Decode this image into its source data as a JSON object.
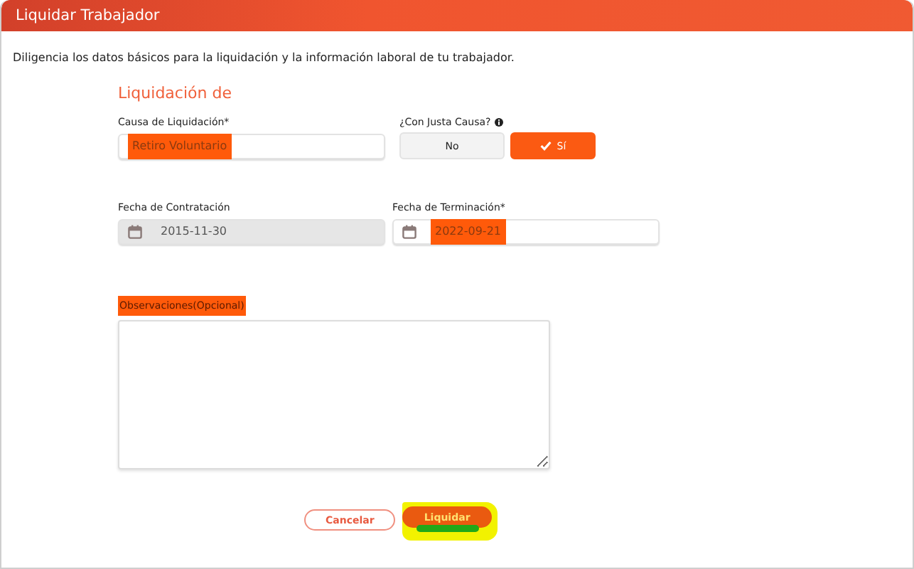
{
  "window": {
    "title": "Liquidar Trabajador"
  },
  "intro": "Diligencia los datos básicos para la liquidación y la información laboral de tu trabajador.",
  "section_title": "Liquidación de",
  "cause": {
    "label": "Causa de Liquidación*",
    "value": "Retiro Voluntario",
    "highlighted": true
  },
  "just_cause": {
    "label": "¿Con Justa Causa?",
    "options": [
      {
        "label": "No",
        "selected": false
      },
      {
        "label": "Sí",
        "selected": true
      }
    ]
  },
  "hire_date": {
    "label": "Fecha de Contratación",
    "value": "2015-11-30",
    "disabled": true,
    "highlighted": false
  },
  "end_date": {
    "label": "Fecha de Terminación*",
    "value": "2022-09-21",
    "disabled": false,
    "highlighted": true
  },
  "notes": {
    "label": "Observaciones(Opcional)",
    "label_highlighted": true
  },
  "buttons": [
    {
      "kind": "secondary",
      "label": "Cancelar",
      "highlighted": false
    },
    {
      "kind": "primary",
      "label": "Liquidar",
      "highlighted": true
    }
  ]
}
